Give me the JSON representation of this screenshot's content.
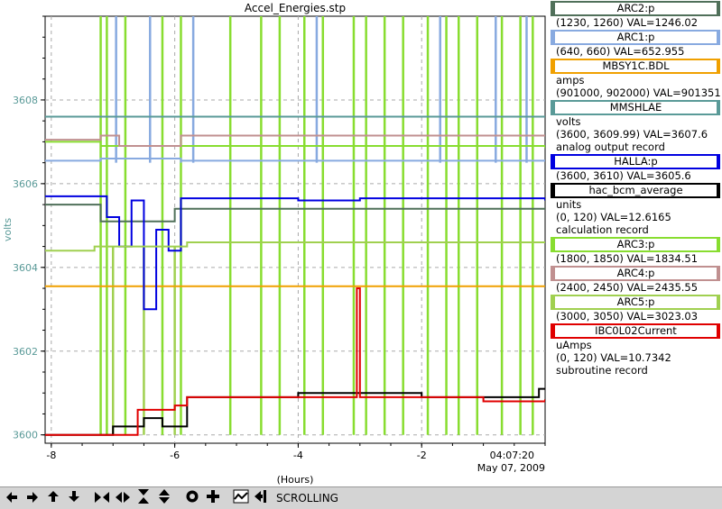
{
  "chart_data": {
    "type": "line",
    "title": "Accel_Energies.stp",
    "xlabel": "(Hours)",
    "ylabel": "volts",
    "xlim": [
      -8.1,
      0
    ],
    "ylim": [
      3599.8,
      3610
    ],
    "x_ticks": [
      -8,
      -6,
      -4,
      -2
    ],
    "x_tick_labels": [
      "-8",
      "-6",
      "-4",
      "-2"
    ],
    "y_ticks": [
      3600,
      3602,
      3604,
      3606,
      3608
    ],
    "y_tick_labels": [
      "3600",
      "3602",
      "3604",
      "3606",
      "3608"
    ],
    "end_time": "04:07:20",
    "end_date": "May 07, 2009",
    "grid": true,
    "series": [
      {
        "name": "ARC2:p",
        "range": "(1230, 1260)",
        "value": "VAL=1246.02",
        "color": "#50705a",
        "x": [
          -8.1,
          -7.2,
          -7.2,
          -6.0,
          -6.0,
          0
        ],
        "y": [
          3605.5,
          3605.5,
          3605.1,
          3605.1,
          3605.4,
          3605.4
        ]
      },
      {
        "name": "ARC1:p",
        "range": "(640, 660)",
        "value": "VAL=652.955",
        "color": "#88aae0",
        "x": [
          -8.1,
          -7.2,
          -7.2,
          -5.9,
          -5.9,
          0
        ],
        "y": [
          3606.55,
          3606.55,
          3606.6,
          3606.5,
          3606.55,
          3606.55
        ]
      },
      {
        "name": "MBSY1C.BDL",
        "range": "(901000, 902000)",
        "value": "VAL=901351",
        "color": "#f0a000",
        "x": [
          -8.1,
          0
        ],
        "y": [
          3603.55,
          3603.55
        ]
      },
      {
        "name": "MMSHLAE",
        "range": "(3600, 3609.99)",
        "value": "VAL=3607.6",
        "color": "#5a9a98",
        "x": [
          -8.1,
          0
        ],
        "y": [
          3607.6,
          3607.6
        ]
      },
      {
        "name": "HALLA:p",
        "range": "(3600, 3610)",
        "value": "VAL=3605.6",
        "color": "#0000e0",
        "x": [
          -8.1,
          -7.2,
          -7.1,
          -6.9,
          -6.7,
          -6.5,
          -6.3,
          -6.1,
          -5.9,
          -4.0,
          -3.0,
          0
        ],
        "y": [
          3605.7,
          3605.7,
          3605.2,
          3604.5,
          3605.6,
          3603.0,
          3604.9,
          3604.4,
          3605.65,
          3605.6,
          3605.65,
          3605.6
        ]
      },
      {
        "name": "hac_bcm_average",
        "range": "(0, 120)",
        "value": "VAL=12.6165",
        "color": "#000000",
        "x": [
          -8.1,
          -7.5,
          -7.0,
          -6.5,
          -6.2,
          -5.8,
          -5.0,
          -4.0,
          -3.0,
          -2.0,
          -1.0,
          -0.1,
          0
        ],
        "y": [
          3600.0,
          3600.0,
          3600.2,
          3600.4,
          3600.2,
          3600.9,
          3600.9,
          3601.0,
          3601.0,
          3600.9,
          3600.9,
          3601.1,
          3601.1
        ]
      },
      {
        "name": "ARC3:p",
        "range": "(1800, 1850)",
        "value": "VAL=1834.51",
        "color": "#88dd30",
        "x": [
          -8.1,
          -7.2,
          -7.2,
          -0.1,
          0
        ],
        "y": [
          3607.0,
          3607.0,
          3606.9,
          3606.9,
          3606.85
        ]
      },
      {
        "name": "ARC4:p",
        "range": "(2400, 2450)",
        "value": "VAL=2435.55",
        "color": "#c09090",
        "x": [
          -8.1,
          -7.2,
          -7.2,
          -6.9,
          -5.9,
          -5.9,
          0
        ],
        "y": [
          3607.05,
          3607.05,
          3607.15,
          3606.9,
          3607.1,
          3607.15,
          3607.15
        ]
      },
      {
        "name": "ARC5:p",
        "range": "(3000, 3050)",
        "value": "VAL=3023.03",
        "color": "#a0d050",
        "x": [
          -8.1,
          -7.3,
          -7.3,
          -6.0,
          -5.8,
          0
        ],
        "y": [
          3604.4,
          3604.4,
          3604.5,
          3604.5,
          3604.6,
          3604.6
        ]
      },
      {
        "name": "IBC0L02Current",
        "range": "(0, 120)",
        "value": "VAL=10.7342",
        "color": "#e00000",
        "x": [
          -8.1,
          -6.8,
          -6.6,
          -6.0,
          -5.8,
          -4.0,
          -3.05,
          -3.05,
          -3.0,
          -3.0,
          -2.0,
          -1.0,
          0
        ],
        "y": [
          3600.0,
          3600.0,
          3600.6,
          3600.7,
          3600.9,
          3600.9,
          3600.9,
          3603.5,
          3603.5,
          3600.9,
          3600.9,
          3600.8,
          3600.85
        ]
      }
    ],
    "spikes": [
      {
        "series": "ARC3:p",
        "color": "#88dd30",
        "x": [
          -7.2,
          -7.1,
          -6.8,
          -6.2,
          -5.9,
          -5.1,
          -4.6,
          -4.3,
          -3.9,
          -3.6,
          -3.1,
          -2.9,
          -2.6,
          -2.3,
          -1.9,
          -1.6,
          -1.4,
          -1.1,
          -0.7,
          -0.4,
          -0.2
        ],
        "low": 3600,
        "high": 3610
      },
      {
        "series": "ARC1:p",
        "color": "#88aae0",
        "x": [
          -6.95,
          -6.4,
          -5.7,
          -3.7,
          -1.7,
          -0.8,
          -0.3
        ],
        "low": 3606.5,
        "high": 3610
      },
      {
        "series": "ARC5:p",
        "color": "#a0d050",
        "x": [
          -7.0,
          -6.5,
          -6.0
        ],
        "low": 3600.0,
        "high": 3604.5
      }
    ]
  },
  "legend": [
    {
      "name": "ARC2:p",
      "color": "#50705a",
      "lines": [
        "(1230, 1260) VAL=1246.02"
      ]
    },
    {
      "name": "ARC1:p",
      "color": "#88aae0",
      "lines": [
        "(640, 660) VAL=652.955"
      ]
    },
    {
      "name": "MBSY1C.BDL",
      "color": "#f0a000",
      "lines": [
        "amps",
        "(901000, 902000)  VAL=901351"
      ]
    },
    {
      "name": "MMSHLAE",
      "color": "#5a9a98",
      "lines": [
        "volts",
        "(3600, 3609.99)  VAL=3607.6",
        "analog output record"
      ]
    },
    {
      "name": "HALLA:p",
      "color": "#0000e0",
      "lines": [
        "(3600, 3610) VAL=3605.6"
      ]
    },
    {
      "name": "hac_bcm_average",
      "color": "#000000",
      "lines": [
        "units",
        "(0, 120) VAL=12.6165",
        "calculation record"
      ]
    },
    {
      "name": "ARC3:p",
      "color": "#88dd30",
      "lines": [
        "(1800, 1850) VAL=1834.51"
      ]
    },
    {
      "name": "ARC4:p",
      "color": "#c09090",
      "lines": [
        "(2400, 2450) VAL=2435.55"
      ]
    },
    {
      "name": "ARC5:p",
      "color": "#a0d050",
      "lines": [
        "(3000, 3050) VAL=3023.03"
      ]
    },
    {
      "name": "IBC0L02Current",
      "color": "#e00000",
      "lines": [
        "uAmps",
        "(0, 120) VAL=10.7342",
        "subroutine record"
      ]
    }
  ],
  "toolbar": {
    "buttons": [
      "left-arrow-icon",
      "right-arrow-icon",
      "up-arrow-icon",
      "down-arrow-icon",
      "compress-horizontal-icon",
      "expand-horizontal-icon",
      "compress-vertical-icon",
      "expand-vertical-icon",
      "record-icon",
      "add-icon",
      "stats-icon",
      "export-icon"
    ],
    "status_label": "SCROLLING"
  }
}
